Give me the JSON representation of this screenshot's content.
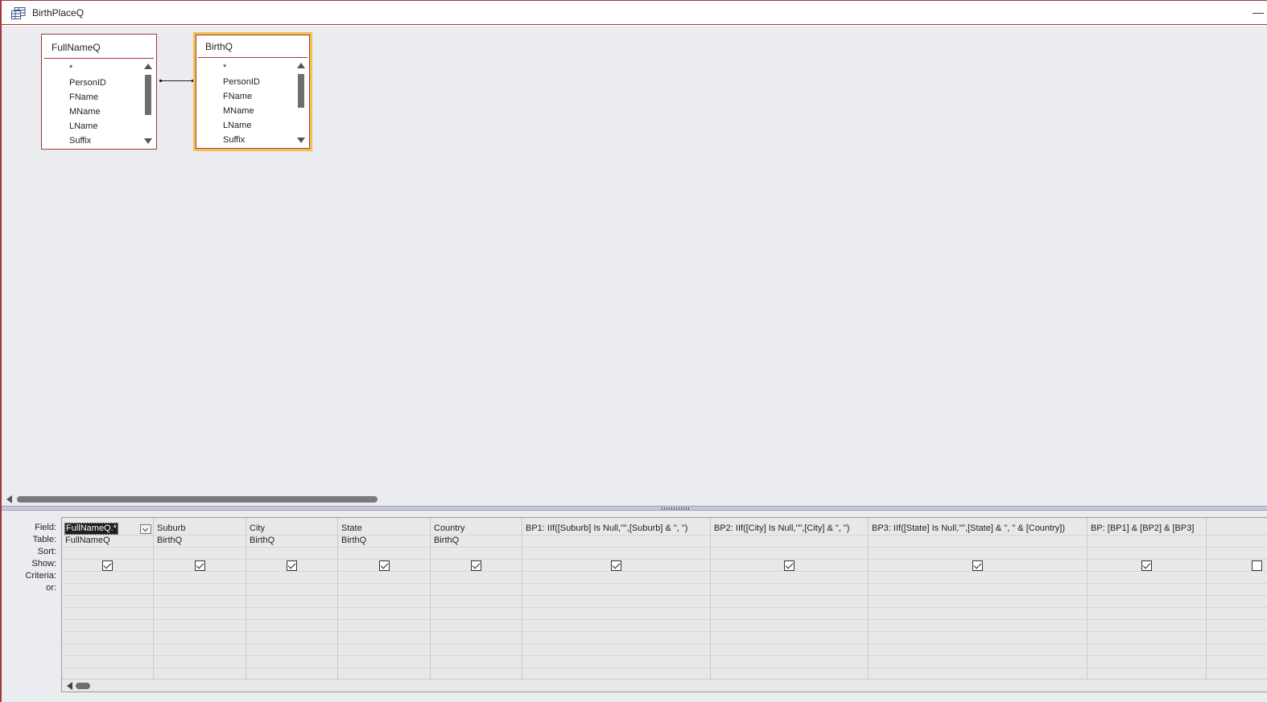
{
  "window": {
    "title": "BirthPlaceQ",
    "minimize_label": "—"
  },
  "tables": [
    {
      "title": "FullNameQ",
      "fields": [
        "*",
        "PersonID",
        "FName",
        "MName",
        "LName",
        "Suffix"
      ]
    },
    {
      "title": "BirthQ",
      "fields": [
        "*",
        "PersonID",
        "FName",
        "MName",
        "LName",
        "Suffix"
      ]
    }
  ],
  "row_labels": {
    "field": "Field:",
    "table": "Table:",
    "sort": "Sort:",
    "show": "Show:",
    "criteria": "Criteria:",
    "or": "or:"
  },
  "columns": [
    {
      "field": "FullNameQ.*",
      "table": "FullNameQ",
      "show": true
    },
    {
      "field": "Suburb",
      "table": "BirthQ",
      "show": true
    },
    {
      "field": "City",
      "table": "BirthQ",
      "show": true
    },
    {
      "field": "State",
      "table": "BirthQ",
      "show": true
    },
    {
      "field": "Country",
      "table": "BirthQ",
      "show": true
    },
    {
      "field": "BP1: IIf([Suburb] Is Null,\"\",[Suburb] & \", \")",
      "table": "",
      "show": true
    },
    {
      "field": "BP2: IIf([City] Is Null,\"\",[City] & \", \")",
      "table": "",
      "show": true
    },
    {
      "field": "BP3: IIf([State] Is Null,\"\",[State] & \", \" & [Country])",
      "table": "",
      "show": true
    },
    {
      "field": "BP: [BP1] & [BP2] & [BP3]",
      "table": "",
      "show": true
    },
    {
      "field": "",
      "table": "",
      "show": false
    }
  ],
  "colors": {
    "accent": "#a4373a",
    "selected_table_border": "#f2c14e",
    "surface": "#eaecef"
  }
}
